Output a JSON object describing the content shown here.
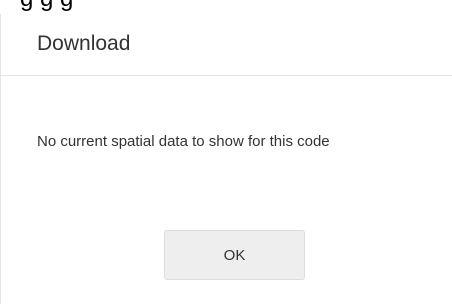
{
  "backdrop": {
    "partial_text": "g g g"
  },
  "dialog": {
    "title": "Download",
    "message": "No current spatial data to show for this code",
    "ok_label": "OK"
  }
}
